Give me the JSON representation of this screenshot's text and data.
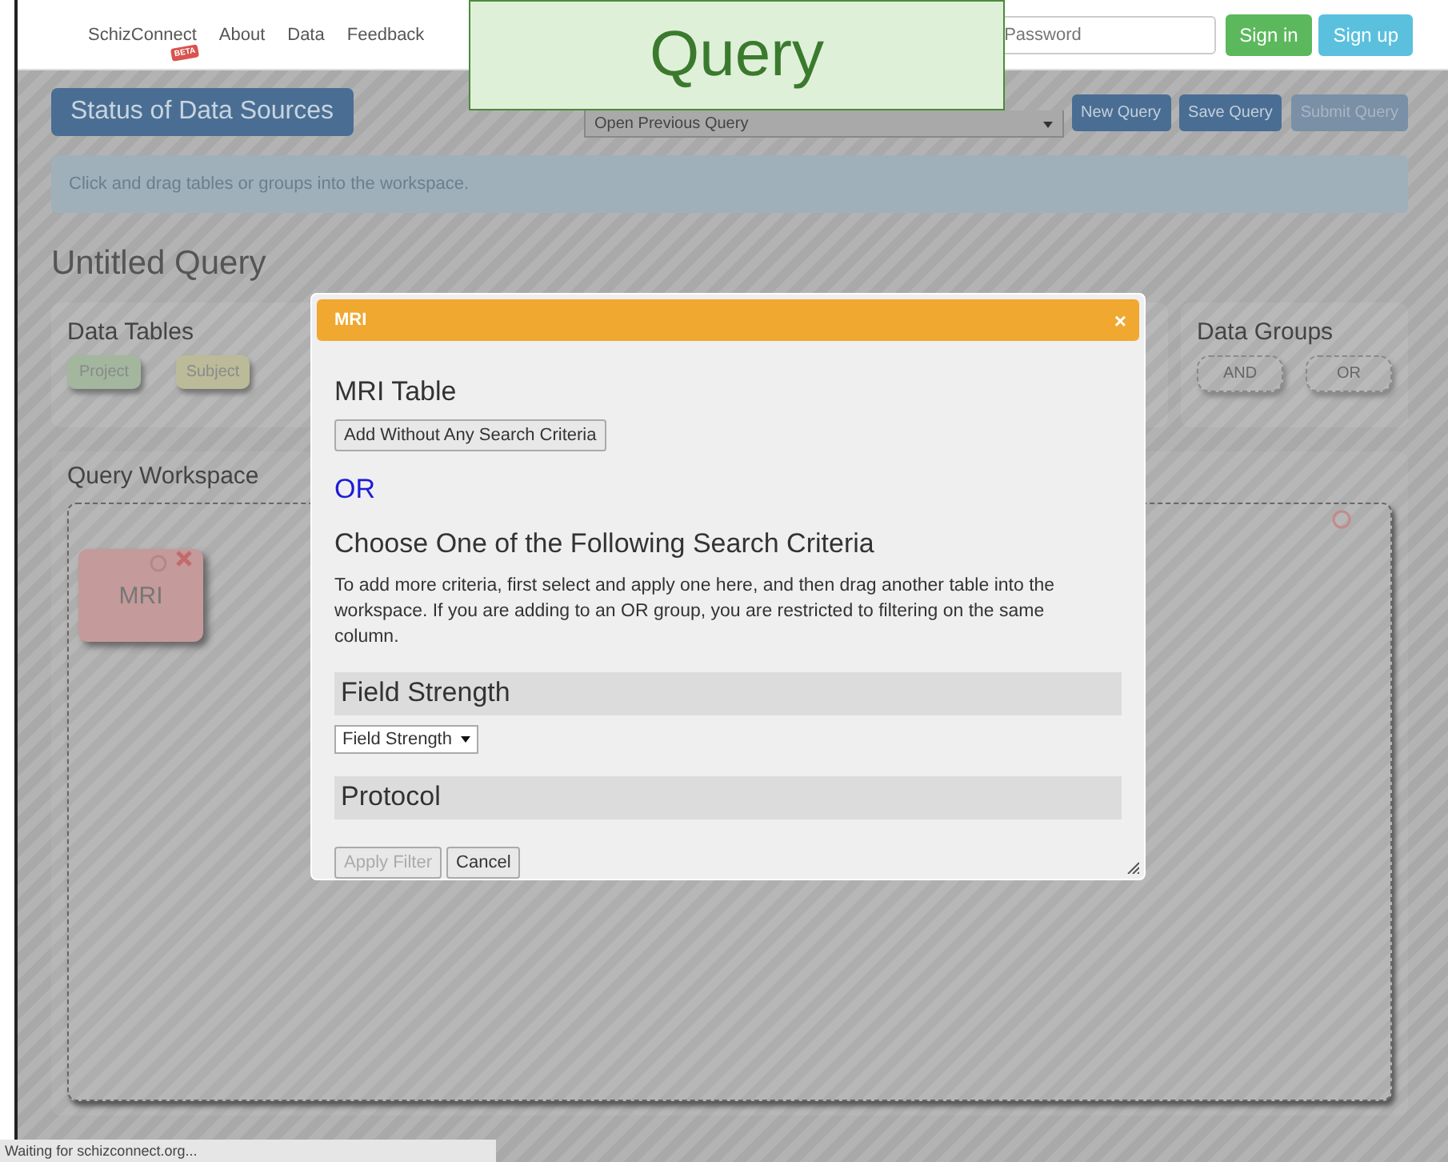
{
  "caption": "Query",
  "navbar": {
    "brand": "SchizConnect",
    "badge": "BETA",
    "links": [
      "About",
      "Data",
      "Feedback"
    ],
    "password": {
      "placeholder": "Password"
    },
    "buttons": [
      {
        "label": "Sign in",
        "kind": "success"
      },
      {
        "label": "Sign up",
        "kind": "info"
      }
    ]
  },
  "toolbar": {
    "status_button": "Status of Data Sources",
    "previous_query": {
      "value": "Open Previous Query"
    },
    "buttons": [
      {
        "label": "New Query",
        "disabled": false
      },
      {
        "label": "Save Query",
        "disabled": false
      },
      {
        "label": "Submit Query",
        "disabled": true
      }
    ]
  },
  "hint": "Click and drag tables or groups into the workspace.",
  "query_title": "Untitled Query",
  "data_tables": {
    "title": "Data Tables",
    "items": [
      {
        "label": "Project",
        "color": "#a2b79e"
      },
      {
        "label": "Subject",
        "color": "#bbbb99"
      }
    ]
  },
  "data_groups": {
    "title": "Data Groups",
    "items": [
      "AND",
      "OR"
    ]
  },
  "workspace": {
    "title": "Query Workspace",
    "tiles": [
      {
        "label": "MRI",
        "color": "#c49a9a"
      }
    ]
  },
  "dialog": {
    "title": "MRI",
    "close": "×",
    "table_title": "MRI Table",
    "add_button": "Add Without Any Search Criteria",
    "or_label": "OR",
    "criteria_title": "Choose One of the Following Search Criteria",
    "instructions": "To add more criteria, first select and apply one here, and then drag another table into the workspace. If you are adding to an OR group, you are restricted to filtering on the same column.",
    "sections": [
      {
        "title": "Field Strength",
        "select": {
          "value": "Field Strength"
        }
      },
      {
        "title": "Protocol"
      }
    ],
    "buttons": [
      {
        "label": "Apply Filter",
        "disabled": true
      },
      {
        "label": "Cancel",
        "disabled": false
      }
    ]
  },
  "status_bar": "Waiting for schizconnect.org..."
}
